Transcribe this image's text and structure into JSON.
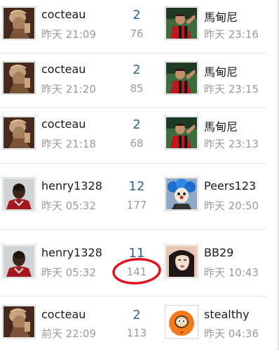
{
  "threads": [
    {
      "author": "cocteau",
      "author_time": "昨天 21:09",
      "replies": "2",
      "views": "76",
      "last_poster": "馬甸尼",
      "last_time": "昨天 23:16",
      "author_avatar": "sculpture-avatar",
      "last_avatar": "soccer-player-avatar"
    },
    {
      "author": "cocteau",
      "author_time": "昨天 21:20",
      "replies": "2",
      "views": "85",
      "last_poster": "馬甸尼",
      "last_time": "昨天 23:15",
      "author_avatar": "sculpture-avatar",
      "last_avatar": "soccer-player-avatar"
    },
    {
      "author": "cocteau",
      "author_time": "昨天 21:18",
      "replies": "2",
      "views": "68",
      "last_poster": "馬甸尼",
      "last_time": "昨天 23:13",
      "author_avatar": "sculpture-avatar",
      "last_avatar": "soccer-player-avatar"
    },
    {
      "author": "henry1328",
      "author_time": "昨天 05:32",
      "replies": "12",
      "views": "177",
      "last_poster": "Peers123",
      "last_time": "昨天 20:50",
      "author_avatar": "footballer-avatar",
      "last_avatar": "clown-avatar"
    },
    {
      "author": "henry1328",
      "author_time": "昨天 05:32",
      "replies": "11",
      "views": "141",
      "last_poster": "BB29",
      "last_time": "昨天 10:43",
      "author_avatar": "footballer-avatar",
      "last_avatar": "woman-avatar"
    },
    {
      "author": "cocteau",
      "author_time": "前天 22:09",
      "replies": "2",
      "views": "113",
      "last_poster": "stealthy",
      "last_time": "昨天 04:36",
      "author_avatar": "sculpture-avatar",
      "last_avatar": "cartoon-kenny-avatar"
    }
  ],
  "annotation": {
    "color": "#e0141e",
    "highlighted_value": "141"
  },
  "colors": {
    "replies": "#2d6796",
    "muted": "#9a9a9a",
    "divider": "#dfe3e6"
  }
}
